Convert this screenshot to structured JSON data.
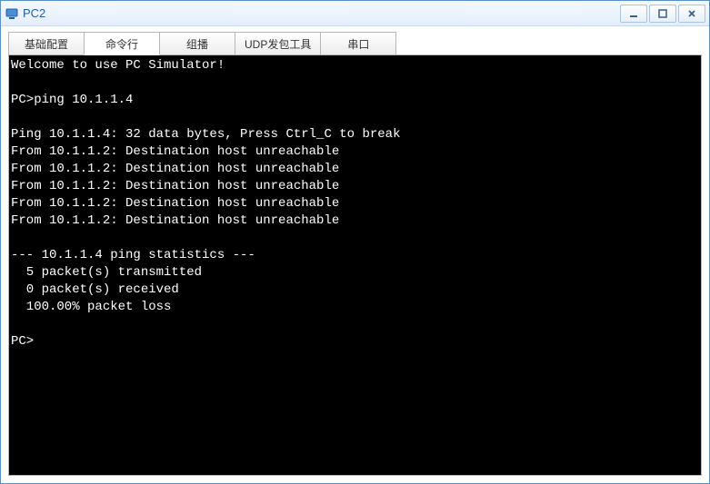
{
  "window": {
    "title": "PC2"
  },
  "tabs": [
    {
      "label": "基础配置"
    },
    {
      "label": "命令行"
    },
    {
      "label": "组播"
    },
    {
      "label": "UDP发包工具"
    },
    {
      "label": "串口"
    }
  ],
  "terminal": {
    "welcome": "Welcome to use PC Simulator!",
    "blank": "",
    "prompt1": "PC>ping 10.1.1.4",
    "pinghdr": "Ping 10.1.1.4: 32 data bytes, Press Ctrl_C to break",
    "l1": "From 10.1.1.2: Destination host unreachable",
    "l2": "From 10.1.1.2: Destination host unreachable",
    "l3": "From 10.1.1.2: Destination host unreachable",
    "l4": "From 10.1.1.2: Destination host unreachable",
    "l5": "From 10.1.1.2: Destination host unreachable",
    "stats_hdr": "--- 10.1.1.4 ping statistics ---",
    "stats_tx": "  5 packet(s) transmitted",
    "stats_rx": "  0 packet(s) received",
    "stats_loss": "  100.00% packet loss",
    "prompt2": "PC>"
  }
}
